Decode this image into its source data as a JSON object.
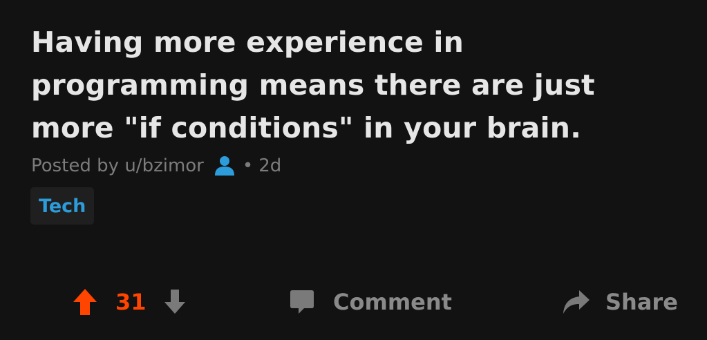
{
  "post": {
    "title": "Having more experience in programming means there are just more \"if conditions\" in your brain.",
    "posted_by_prefix": "Posted by",
    "author": "u/bzimor",
    "separator": "•",
    "age": "2d",
    "flair": "Tech"
  },
  "actions": {
    "score": "31",
    "comment_label": "Comment",
    "share_label": "Share"
  },
  "icons": {
    "user": "user-icon",
    "upvote": "upvote-arrow-icon",
    "downvote": "downvote-arrow-icon",
    "comment": "comment-bubble-icon",
    "share": "share-arrow-icon"
  },
  "colors": {
    "background": "#121212",
    "title": "#e6e6e6",
    "meta": "#7c7c7c",
    "user_icon": "#2d9cdb",
    "flair_text": "#2d9cdb",
    "flair_bg": "#1f1f1f",
    "upvote": "#ff4500",
    "action_gray": "#8a8a8a"
  }
}
